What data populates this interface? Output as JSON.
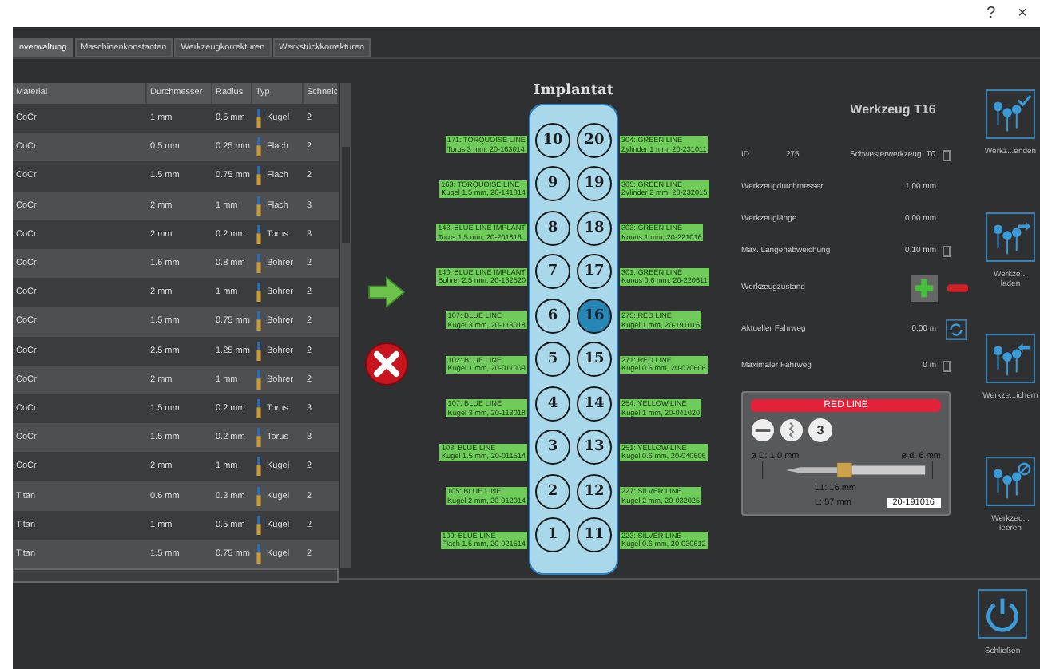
{
  "window_controls": {
    "help": "?",
    "close": "×"
  },
  "tabs": [
    {
      "label": "nverwaltung",
      "selected": true
    },
    {
      "label": "Maschinenkonstanten",
      "selected": false
    },
    {
      "label": "Werkzeugkorrekturen",
      "selected": false
    },
    {
      "label": "Werkstückkorrekturen",
      "selected": false
    }
  ],
  "table": {
    "columns": [
      "Material",
      "Durchmesser",
      "Radius",
      "Typ",
      "Schneic"
    ],
    "rows": [
      {
        "material": "CoCr",
        "diameter": "1 mm",
        "radius": "0.5 mm",
        "type": "Kugel",
        "flutes": "2"
      },
      {
        "material": "CoCr",
        "diameter": "0.5 mm",
        "radius": "0.25 mm",
        "type": "Flach",
        "flutes": "2"
      },
      {
        "material": "CoCr",
        "diameter": "1.5 mm",
        "radius": "0.75 mm",
        "type": "Flach",
        "flutes": "2"
      },
      {
        "material": "CoCr",
        "diameter": "2 mm",
        "radius": "1 mm",
        "type": "Flach",
        "flutes": "3"
      },
      {
        "material": "CoCr",
        "diameter": "2 mm",
        "radius": "0.2 mm",
        "type": "Torus",
        "flutes": "3"
      },
      {
        "material": "CoCr",
        "diameter": "1.6 mm",
        "radius": "0.8 mm",
        "type": "Bohrer",
        "flutes": "2"
      },
      {
        "material": "CoCr",
        "diameter": "2 mm",
        "radius": "1 mm",
        "type": "Bohrer",
        "flutes": "2"
      },
      {
        "material": "CoCr",
        "diameter": "1.5 mm",
        "radius": "0.75 mm",
        "type": "Bohrer",
        "flutes": "2"
      },
      {
        "material": "CoCr",
        "diameter": "2.5 mm",
        "radius": "1.25 mm",
        "type": "Bohrer",
        "flutes": "2"
      },
      {
        "material": "CoCr",
        "diameter": "2 mm",
        "radius": "1 mm",
        "type": "Bohrer",
        "flutes": "2"
      },
      {
        "material": "CoCr",
        "diameter": "1.5 mm",
        "radius": "0.2 mm",
        "type": "Torus",
        "flutes": "3"
      },
      {
        "material": "CoCr",
        "diameter": "1.5 mm",
        "radius": "0.2 mm",
        "type": "Torus",
        "flutes": "3"
      },
      {
        "material": "CoCr",
        "diameter": "2 mm",
        "radius": "1 mm",
        "type": "Kugel",
        "flutes": "2"
      },
      {
        "material": "Titan",
        "diameter": "0.6 mm",
        "radius": "0.3 mm",
        "type": "Kugel",
        "flutes": "2"
      },
      {
        "material": "Titan",
        "diameter": "1 mm",
        "radius": "0.5 mm",
        "type": "Kugel",
        "flutes": "2"
      },
      {
        "material": "Titan",
        "diameter": "1.5 mm",
        "radius": "0.75 mm",
        "type": "Kugel",
        "flutes": "2"
      }
    ]
  },
  "implant": {
    "title": "Implantat",
    "left_slots": [
      {
        "number": "10",
        "name": "171: TORQUOISE LINE",
        "spec": "Torus 3 mm, 20-163014",
        "selected": false
      },
      {
        "number": "9",
        "name": "163: TORQUOISE LINE",
        "spec": "Kugel 1.5 mm, 20-141814",
        "selected": false
      },
      {
        "number": "8",
        "name": "143: BLUE LINE IMPLANT",
        "spec": "Torus 1.5 mm, 20-201816",
        "selected": false
      },
      {
        "number": "7",
        "name": "140: BLUE LINE IMPLANT",
        "spec": "Bohrer 2.5 mm, 20-132520",
        "selected": false
      },
      {
        "number": "6",
        "name": "107: BLUE LINE",
        "spec": "Kugel 3 mm, 20-113018",
        "selected": false
      },
      {
        "number": "5",
        "name": "102: BLUE LINE",
        "spec": "Kugel 1 mm, 20-011009",
        "selected": false
      },
      {
        "number": "4",
        "name": "107: BLUE LINE",
        "spec": "Kugel 3 mm, 20-113018",
        "selected": false
      },
      {
        "number": "3",
        "name": "103: BLUE LINE",
        "spec": "Kugel 1.5 mm, 20-011514",
        "selected": false
      },
      {
        "number": "2",
        "name": "105: BLUE LINE",
        "spec": "Kugel 2 mm, 20-012014",
        "selected": false
      },
      {
        "number": "1",
        "name": "109: BLUE LINE",
        "spec": "Flach 1.5 mm, 20-021514",
        "selected": false
      }
    ],
    "right_slots": [
      {
        "number": "20",
        "name": "304: GREEN LINE",
        "spec": "Zylinder 1 mm, 20-231011",
        "selected": false
      },
      {
        "number": "19",
        "name": "305: GREEN LINE",
        "spec": "Zylinder 2 mm, 20-232015",
        "selected": false
      },
      {
        "number": "18",
        "name": "303: GREEN LINE",
        "spec": "Konus 1 mm, 20-221016",
        "selected": false
      },
      {
        "number": "17",
        "name": "301: GREEN LINE",
        "spec": "Konus 0.6 mm, 20-220611",
        "selected": false
      },
      {
        "number": "16",
        "name": "275: RED LINE",
        "spec": "Kugel 1 mm, 20-191016",
        "selected": true
      },
      {
        "number": "15",
        "name": "271: RED LINE",
        "spec": "Kugel 0.6 mm, 20-070606",
        "selected": false
      },
      {
        "number": "14",
        "name": "254: YELLOW LINE",
        "spec": "Kugel 1 mm, 20-041020",
        "selected": false
      },
      {
        "number": "13",
        "name": "251: YELLOW LINE",
        "spec": "Kugel 0.6 mm, 20-040606",
        "selected": false
      },
      {
        "number": "12",
        "name": "227: SILVER LINE",
        "spec": "Kugel 2 mm, 20-032025",
        "selected": false
      },
      {
        "number": "11",
        "name": "223: SILVER LINE",
        "spec": "Kugel 0.6 mm, 20-030612",
        "selected": false
      }
    ]
  },
  "tool": {
    "title": "Werkzeug T16",
    "fields": [
      {
        "kind": "id",
        "label": "ID",
        "value": "275",
        "label2": "Schwesterwerkzeug",
        "value2": "T0"
      },
      {
        "kind": "value",
        "label": "Werkzeugdurchmesser",
        "value": "1,00 mm"
      },
      {
        "kind": "value",
        "label": "Werkzeuglänge",
        "value": "0,00 mm"
      },
      {
        "kind": "spin",
        "label": "Max. Längenabweichung",
        "value": "0,10 mm"
      },
      {
        "kind": "state",
        "label": "Werkzeugzustand"
      },
      {
        "kind": "refresh",
        "label": "Aktueller Fahrweg",
        "value": "0,00 m"
      },
      {
        "kind": "spin",
        "label": "Maximaler Fahrweg",
        "value": "0 m"
      }
    ],
    "card": {
      "title": "RED LINE",
      "flute_count": "3",
      "diameter": "ø D: 1,0 mm",
      "shank": "ø d: 6 mm",
      "l1": "L1: 16 mm",
      "length": "L: 57 mm",
      "article": "20-191016"
    }
  },
  "actions": [
    {
      "kind": "check",
      "label": "Werkz...enden"
    },
    {
      "kind": "load",
      "label": "Werkze...\nladen"
    },
    {
      "kind": "save",
      "label": "Werkze...ichern"
    },
    {
      "kind": "clear",
      "label": "Werkzeu...\nleeren"
    }
  ],
  "footer": {
    "close": "Schließen"
  }
}
